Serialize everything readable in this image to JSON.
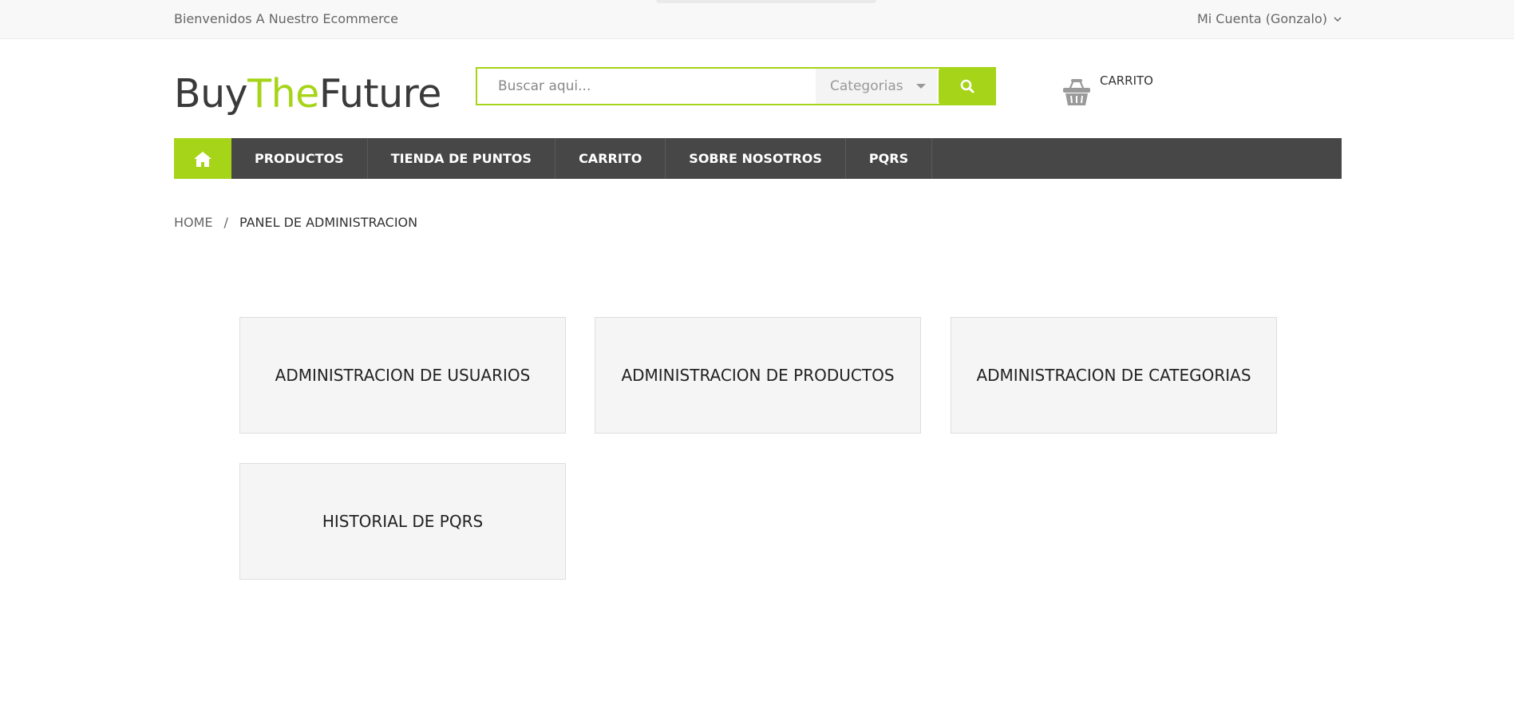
{
  "topbar": {
    "welcome": "Bienvenidos A Nuestro Ecommerce",
    "account": "Mi Cuenta (Gonzalo)",
    "account_icon": "chevron-down-icon"
  },
  "logo": {
    "part1": "Buy",
    "part2": "The",
    "part3": "Future"
  },
  "search": {
    "placeholder": "Buscar aqui...",
    "category": "Categorias",
    "button_icon": "search-icon"
  },
  "cart": {
    "label": "CARRITO",
    "icon": "basket-icon"
  },
  "nav": {
    "home_icon": "home-icon",
    "items": [
      {
        "label": "PRODUCTOS"
      },
      {
        "label": "TIENDA DE PUNTOS"
      },
      {
        "label": "CARRITO"
      },
      {
        "label": "SOBRE NOSOTROS"
      },
      {
        "label": "PQRS"
      }
    ]
  },
  "breadcrumb": {
    "home": "HOME",
    "separator": "/",
    "current": "PANEL DE ADMINISTRACION"
  },
  "cards": [
    {
      "label": "ADMINISTRACION DE USUARIOS"
    },
    {
      "label": "ADMINISTRACION DE PRODUCTOS"
    },
    {
      "label": "ADMINISTRACION DE CATEGORIAS"
    },
    {
      "label": "HISTORIAL DE PQRS"
    }
  ],
  "colors": {
    "accent": "#a6d418",
    "nav_bg": "#474747",
    "card_bg": "#f5f5f5"
  }
}
